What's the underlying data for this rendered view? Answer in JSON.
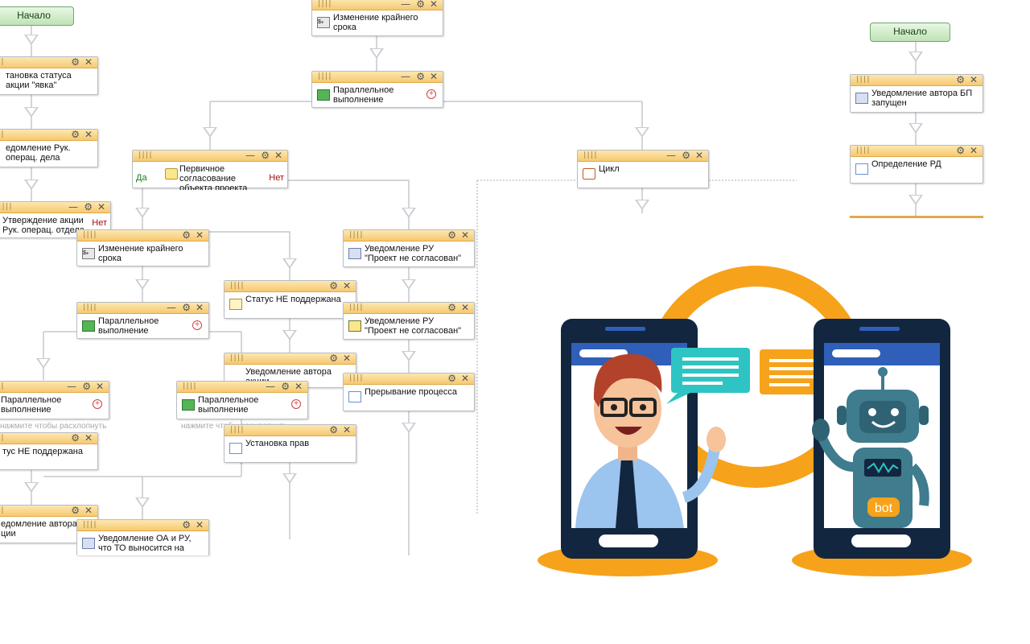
{
  "start_label": "Начало",
  "start_label_2": "Начало",
  "hint": "нажмите чтобы расхлопнуть",
  "hint_2": "нажмите чтобы расхлопнуть",
  "yes": "Да",
  "no": "Нет",
  "no_2": "Нет",
  "nodes": {
    "status_set": "тановка статуса акции \"явка\"",
    "notify_head": "едомление Рук. операц. дела",
    "approve_promo": "Утверждение акции Рук. операц. отдела",
    "change_deadline_top": "Изменение крайнего срока",
    "parallel_top": "Параллельное выполнение",
    "primary_approval": "Первичное согласование объекта проекта",
    "change_deadline_mid": "Изменение крайнего срока",
    "parallel_mid": "Параллельное выполнение",
    "parallel_left": "Параллельное выполнение",
    "status_not_supported_left": "тус НЕ поддержана",
    "notify_author_left": "едомление автора ции",
    "notify_oa": "Уведомление ОА и РУ, что ТО выносится на",
    "status_not_supported": "Статус НЕ поддержана",
    "notify_author_mid": "Уведомление автора акции",
    "parallel_mid2": "Параллельное выполнение",
    "set_rights": "Установка прав",
    "notify_ru_1": "Уведомление РУ \"Проект не согласован\"",
    "notify_ru_2": "Уведомление РУ \"Проект не согласован\"",
    "interrupt": "Прерывание процесса",
    "cycle": "Цикл",
    "notify_bp": "Уведомление автора БП запущен",
    "define_rd": "Определение РД"
  },
  "illustration": {
    "bot_badge": "bot",
    "colors": {
      "orange": "#f7a21b",
      "navy": "#12263f",
      "blue": "#2f5fb8",
      "cyan": "#2ec4c4",
      "robot": "#3e7c8e"
    }
  }
}
